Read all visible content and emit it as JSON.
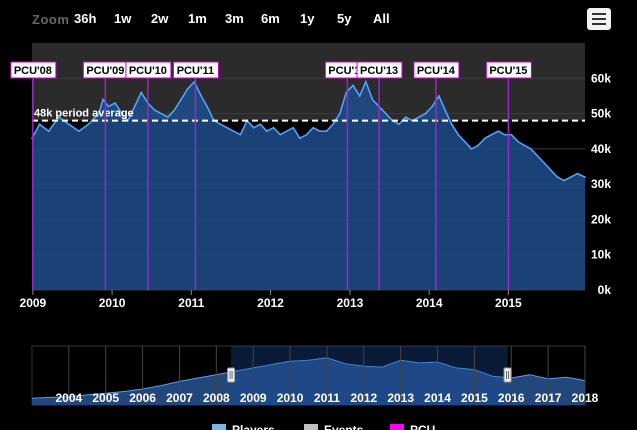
{
  "zoom": {
    "label": "Zoom",
    "buttons": [
      "36h",
      "1w",
      "2w",
      "1m",
      "3m",
      "6m",
      "1y",
      "5y",
      "All"
    ]
  },
  "menu_icon": "hamburger-menu-icon",
  "colors": {
    "background": "#000000",
    "area_fill": "#1f4e8c",
    "line": "#4fa2ff",
    "event_line": "#9b27c7",
    "event_border": "#cc00cc",
    "gridline": "#3a3a3a",
    "navigator_fill": "#23477a",
    "navigator_mask": "#13315a",
    "legend_players": "#7cb5ec",
    "legend_events": "#c0c0c0",
    "legend_pcu": "#ff00ff"
  },
  "chart_data": {
    "type": "area",
    "ylim": [
      0,
      70000
    ],
    "y_ticks": [
      "0k",
      "10k",
      "20k",
      "30k",
      "40k",
      "50k",
      "60k"
    ],
    "x_ticks": [
      "2009",
      "2010",
      "2011",
      "2012",
      "2013",
      "2014",
      "2015"
    ],
    "xlim": [
      "2008-12-28",
      "2015-12-20"
    ],
    "grid": true,
    "plot_band": {
      "from": 48000,
      "to": 70000
    },
    "plot_line": {
      "value": 48000,
      "label": "48k period average"
    },
    "series": [
      {
        "name": "Players",
        "x": [
          "2008-12-28",
          "2009-02-01",
          "2009-03-15",
          "2009-05-01",
          "2009-06-15",
          "2009-08-01",
          "2009-09-15",
          "2009-11-01",
          "2009-11-20",
          "2009-12-15",
          "2010-01-15",
          "2010-02-15",
          "2010-03-15",
          "2010-04-15",
          "2010-05-15",
          "2010-06-15",
          "2010-07-15",
          "2010-08-15",
          "2010-09-15",
          "2010-10-15",
          "2010-11-15",
          "2010-12-15",
          "2011-01-15",
          "2011-02-15",
          "2011-03-15",
          "2011-04-15",
          "2011-05-15",
          "2011-06-15",
          "2011-07-15",
          "2011-08-15",
          "2011-09-15",
          "2011-10-15",
          "2011-11-15",
          "2011-12-15",
          "2012-01-15",
          "2012-02-15",
          "2012-03-15",
          "2012-04-15",
          "2012-05-15",
          "2012-06-15",
          "2012-07-15",
          "2012-08-15",
          "2012-09-15",
          "2012-10-15",
          "2012-11-15",
          "2012-12-15",
          "2013-01-15",
          "2013-02-15",
          "2013-03-15",
          "2013-04-15",
          "2013-05-15",
          "2013-06-15",
          "2013-07-15",
          "2013-08-15",
          "2013-09-15",
          "2013-10-15",
          "2013-11-15",
          "2013-12-15",
          "2014-01-15",
          "2014-02-15",
          "2014-03-15",
          "2014-04-15",
          "2014-05-15",
          "2014-06-15",
          "2014-07-15",
          "2014-08-15",
          "2014-09-15",
          "2014-10-15",
          "2014-11-15",
          "2014-12-15",
          "2015-01-15",
          "2015-02-15",
          "2015-03-15",
          "2015-04-15",
          "2015-05-15",
          "2015-06-15",
          "2015-07-15",
          "2015-08-15",
          "2015-09-15",
          "2015-10-15",
          "2015-11-15",
          "2015-12-20"
        ],
        "values": [
          43000,
          47000,
          45000,
          49000,
          47000,
          45000,
          47000,
          50000,
          54000,
          52000,
          53000,
          50000,
          48000,
          52000,
          56000,
          53000,
          51000,
          50000,
          49000,
          51000,
          54000,
          57000,
          59000,
          55000,
          52000,
          48000,
          47000,
          46000,
          45000,
          44000,
          48000,
          46000,
          47000,
          45000,
          46000,
          44000,
          45000,
          46000,
          43000,
          44000,
          46000,
          45000,
          45000,
          47000,
          50000,
          56000,
          58000,
          55000,
          59000,
          54000,
          52000,
          50000,
          48000,
          47000,
          49000,
          48000,
          49000,
          50000,
          52000,
          55000,
          51000,
          47000,
          44000,
          42000,
          40000,
          41000,
          43000,
          44000,
          45000,
          44000,
          44000,
          42000,
          41000,
          40000,
          38000,
          36000,
          34000,
          32000,
          31000,
          32000,
          33000,
          32000
        ]
      }
    ],
    "events": [
      {
        "label": "PCU'08",
        "date": "2009-01-01"
      },
      {
        "label": "PCU'09",
        "date": "2009-12-01"
      },
      {
        "label": "PCU'10",
        "date": "2010-06-15"
      },
      {
        "label": "PCU'11",
        "date": "2011-01-20"
      },
      {
        "label": "PCU'12",
        "date": "2012-12-20"
      },
      {
        "label": "PCU'13",
        "date": "2013-05-15"
      },
      {
        "label": "PCU'14",
        "date": "2014-02-01"
      },
      {
        "label": "PCU'15",
        "date": "2015-01-01"
      }
    ],
    "navigator": {
      "x_ticks": [
        "2004",
        "2005",
        "2006",
        "2007",
        "2008",
        "2009",
        "2010",
        "2011",
        "2012",
        "2013",
        "2014",
        "2015",
        "2016",
        "2017",
        "2018"
      ],
      "xlim": [
        2003.0,
        2018.0
      ],
      "ylim": [
        0,
        70000
      ],
      "selection": [
        2008.4,
        2015.9
      ],
      "x": [
        2003.0,
        2003.5,
        2004.0,
        2004.5,
        2005.0,
        2005.5,
        2006.0,
        2006.5,
        2007.0,
        2007.5,
        2008.0,
        2008.5,
        2009.0,
        2009.5,
        2010.0,
        2010.5,
        2011.0,
        2011.5,
        2012.0,
        2012.5,
        2013.0,
        2013.5,
        2014.0,
        2014.5,
        2015.0,
        2015.5,
        2016.0,
        2016.5,
        2017.0,
        2017.5,
        2018.0
      ],
      "values": [
        8000,
        9000,
        10000,
        12000,
        14000,
        16000,
        19000,
        23000,
        28000,
        32000,
        36000,
        40000,
        44000,
        48000,
        52000,
        53000,
        56000,
        49000,
        46000,
        45000,
        53000,
        50000,
        51000,
        44000,
        42000,
        34000,
        32000,
        36000,
        31000,
        33000,
        29000
      ]
    },
    "legend": [
      "Players",
      "Events",
      "PCU"
    ]
  }
}
